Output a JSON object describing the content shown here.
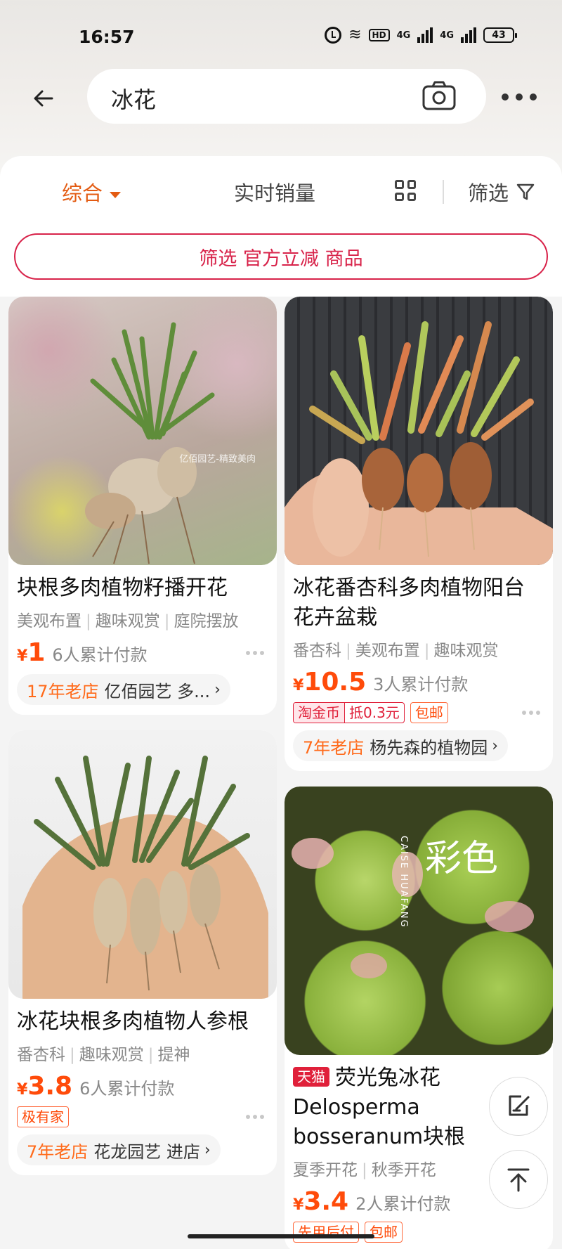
{
  "status_bar": {
    "time": "16:57",
    "battery": "43",
    "hd_label": "HD",
    "net1": "4G",
    "net2": "4G"
  },
  "search": {
    "query": "冰花"
  },
  "sort_bar": {
    "comprehensive": "综合",
    "realtime_sales": "实时销量",
    "filter": "筛选"
  },
  "promo_filter": {
    "label": "筛选 官方立减 商品"
  },
  "products": [
    {
      "title": "块根多肉植物籽播开花",
      "tags": [
        "美观布置",
        "趣味观赏",
        "庭院摆放"
      ],
      "currency": "¥",
      "price": "1",
      "sold": "6人累计付款",
      "store_age": "17年老店",
      "store_name": "亿佰园艺 多...",
      "photo": "succulent-caudex-photo",
      "watermark": "亿佰园艺-精致美肉"
    },
    {
      "title": "冰花块根多肉植物人参根",
      "tags": [
        "番杏科",
        "趣味观赏",
        "提神"
      ],
      "currency": "¥",
      "price": "3.8",
      "sold": "6人累计付款",
      "badges": [
        "极有家"
      ],
      "store_age": "7年老店",
      "store_name": "花龙园艺 进店",
      "photo": "ginseng-root-succulent-photo"
    },
    {
      "title": "冰花番杏科多肉植物阳台花卉盆栽",
      "tags": [
        "番杏科",
        "美观布置",
        "趣味观赏"
      ],
      "currency": "¥",
      "price": "10.5",
      "sold": "3人累计付款",
      "coin_badge": {
        "name": "淘金币",
        "value": "抵0.3元"
      },
      "badges": [
        "包邮"
      ],
      "store_age": "7年老店",
      "store_name": "杨先森的植物园",
      "photo": "ice-plant-in-hand-photo"
    },
    {
      "tmall_tag": "天猫",
      "title": "荧光兔冰花Delosperma bosseranum块根",
      "tags": [
        "夏季开花",
        "秋季开花"
      ],
      "currency": "¥",
      "price": "3.4",
      "sold": "2人累计付款",
      "badges": [
        "先用后付",
        "包邮"
      ],
      "photo": "delosperma-closeup-photo",
      "watermark_brand": "彩色",
      "watermark_sub": "CAISE HUAFANG"
    }
  ],
  "colors": {
    "accent": "#e35b12",
    "price": "#ff4b0a",
    "promo": "#d8234a",
    "tmall": "#e0203a"
  },
  "icons": [
    "back-arrow-icon",
    "camera-icon",
    "more-icon",
    "sort-caret-icon",
    "grid-view-icon",
    "filter-funnel-icon",
    "chevron-right-icon",
    "feedback-edit-icon",
    "back-to-top-icon"
  ]
}
